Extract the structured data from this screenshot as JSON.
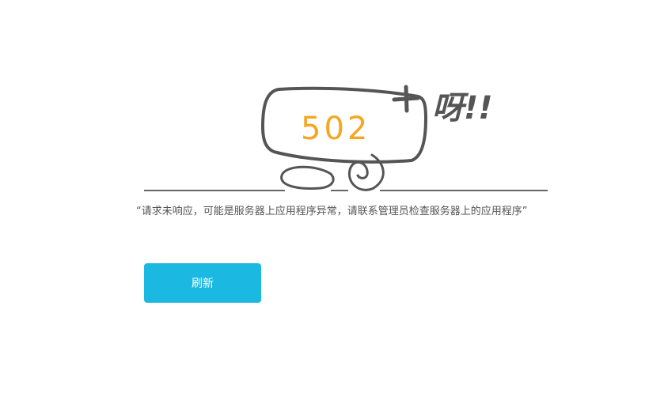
{
  "illustration": {
    "code": "502",
    "exclamation": "呀!!",
    "code_color": "#f5a623",
    "stroke_color": "#555555"
  },
  "message": {
    "text": "“请求未响应，可能是服务器上应用程序异常，请联系管理员检查服务器上的应用程序”"
  },
  "actions": {
    "refresh_label": "刷新",
    "refresh_color": "#1bb8e2"
  }
}
